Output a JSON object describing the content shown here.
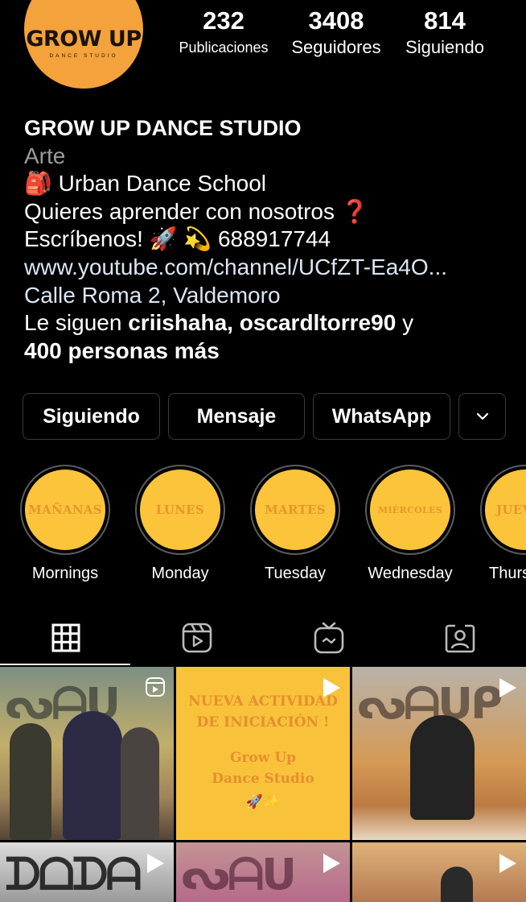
{
  "profile": {
    "avatar_text": "GROW UP",
    "avatar_subtext": "DANCE STUDIO",
    "stats": {
      "posts": {
        "value": "232",
        "label": "Publicaciones"
      },
      "followers": {
        "value": "3408",
        "label": "Seguidores"
      },
      "following": {
        "value": "814",
        "label": "Siguiendo"
      }
    },
    "name": "GROW UP DANCE STUDIO",
    "category": "Arte",
    "bio_line1": "Urban Dance School",
    "bio_line2": "Quieres aprender con nosotros",
    "bio_line3_text": "Escríbenos!",
    "bio_line3_phone": "688917744",
    "link": "www.youtube.com/channel/UCfZT-Ea4O...",
    "address": "Calle Roma 2, Valdemoro",
    "followed_by_prefix": "Le siguen",
    "followed_by_user1": "criishaha",
    "followed_by_user2": "oscardltorre90",
    "followed_by_and": "y",
    "followed_by_more": "400 personas más"
  },
  "actions": {
    "following": "Siguiendo",
    "message": "Mensaje",
    "whatsapp": "WhatsApp"
  },
  "highlights": [
    {
      "cover_text": "MAÑANAS",
      "label": "Mornings"
    },
    {
      "cover_text": "LUNES",
      "label": "Monday"
    },
    {
      "cover_text": "MARTES",
      "label": "Tuesday"
    },
    {
      "cover_text": "MIÉRCOLES",
      "label": "Wednesday"
    },
    {
      "cover_text": "JUEVES",
      "label": "Thursday"
    }
  ],
  "posts": {
    "post2_line1": "NUEVA ACTIVIDAD",
    "post2_line2": "DE INICIACIÓN !",
    "post2_line3": "Grow Up",
    "post2_line4": "Dance Studio",
    "post2_emoji": "🚀✨"
  },
  "colors": {
    "background": "#000000",
    "avatar": "#f3a23c",
    "highlight": "#fbc43a",
    "link": "#dbe6f4"
  }
}
